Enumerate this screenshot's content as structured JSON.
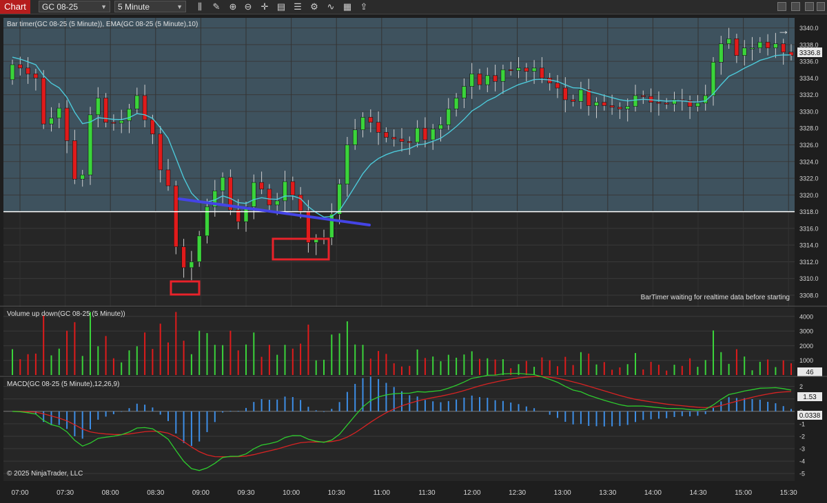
{
  "toolbar": {
    "chart_tab": "Chart",
    "instrument": "GC 08-25",
    "interval": "5 Minute",
    "icons": [
      "bar-type-icon",
      "drawing-tools-icon",
      "zoom-in-icon",
      "zoom-out-icon",
      "crosshair-icon",
      "data-box-icon",
      "properties-icon",
      "strategies-icon",
      "indicators-icon",
      "templates-icon",
      "share-icon"
    ]
  },
  "panels": {
    "price": {
      "label": "Bar timer(GC 08-25 (5 Minute)), EMA(GC 08-25 (5 Minute),10)",
      "status_text": "BarTimer waiting for realtime data before starting",
      "current_price": "3336.8",
      "axis_ticks": [
        "3340.0",
        "3338.0",
        "3336.0",
        "3334.0",
        "3332.0",
        "3330.0",
        "3328.0",
        "3326.0",
        "3324.0",
        "3322.0",
        "3320.0",
        "3318.0",
        "3316.0",
        "3314.0",
        "3312.0",
        "3310.0",
        "3308.0"
      ],
      "horizontal_line_price": 3318.0
    },
    "volume": {
      "label": "Volume up down(GC 08-25 (5 Minute))",
      "current_value": "46",
      "axis_ticks": [
        "4000",
        "3000",
        "2000",
        "1000"
      ]
    },
    "macd": {
      "label": "MACD(GC 08-25 (5 Minute),12,26,9)",
      "current_macd": "1.53",
      "current_diff": "0.0338",
      "axis_ticks": [
        "2",
        "1",
        "0",
        "-1",
        "-2",
        "-3",
        "-4",
        "-5"
      ]
    }
  },
  "time_axis": [
    "07:00",
    "07:30",
    "08:00",
    "08:30",
    "09:00",
    "09:30",
    "10:00",
    "10:30",
    "11:00",
    "11:30",
    "12:00",
    "12:30",
    "13:00",
    "13:30",
    "14:00",
    "14:30",
    "15:00",
    "15:30"
  ],
  "copyright": "© 2025 NinjaTrader, LLC",
  "colors": {
    "up": "#3ad43a",
    "down": "#e01b1b",
    "ema": "#4cc9d9",
    "macd": "#2ecc2e",
    "signal": "#d92323",
    "diff": "#3d8ee6",
    "trendline": "#4444e6",
    "highlight_box": "#e8222a"
  }
}
